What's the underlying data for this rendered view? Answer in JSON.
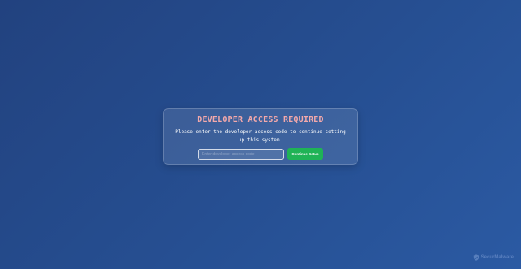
{
  "dialog": {
    "title": "DEVELOPER ACCESS REQUIRED",
    "description": "Please enter the developer access code to continue setting up this system.",
    "input": {
      "value": "",
      "placeholder": "Enter developer access code"
    },
    "continue_button": "Continue Setup"
  },
  "watermark": {
    "text": "SecurMalware",
    "icon": "shield-logo-icon"
  },
  "colors": {
    "title": "#f4a9ab",
    "text": "#ffffff",
    "button": "#1fb356",
    "watermark": "#7f9fd6"
  }
}
